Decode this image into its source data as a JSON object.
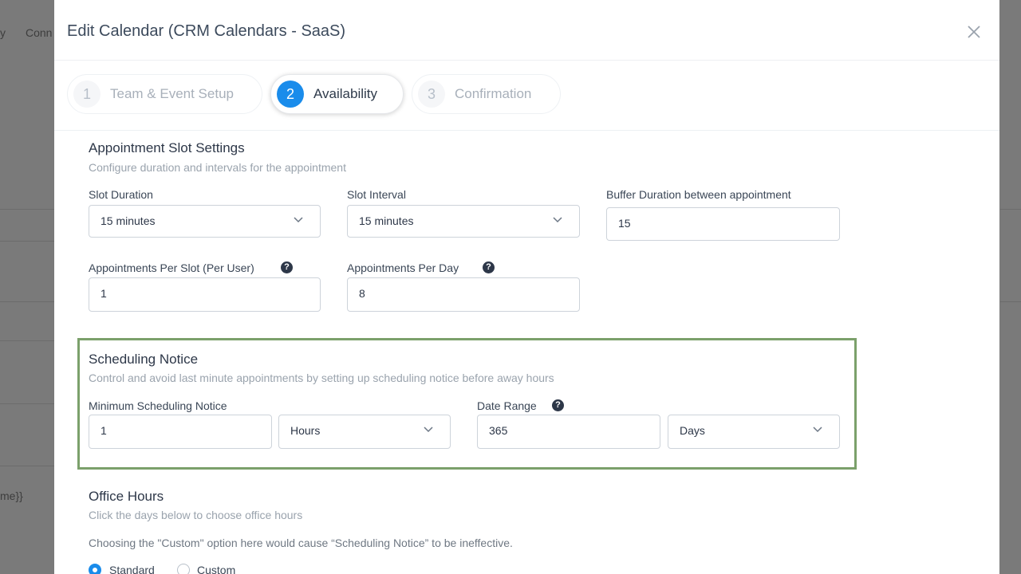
{
  "background": {
    "text_top": "y",
    "text_top2": "Conn",
    "text_left": "me}}"
  },
  "modal": {
    "title": "Edit Calendar (CRM Calendars - SaaS)"
  },
  "steps": [
    {
      "number": "1",
      "label": "Team & Event Setup",
      "active": false
    },
    {
      "number": "2",
      "label": "Availability",
      "active": true
    },
    {
      "number": "3",
      "label": "Confirmation",
      "active": false
    }
  ],
  "slot_settings": {
    "title": "Appointment Slot Settings",
    "subtitle": "Configure duration and intervals for the appointment",
    "slot_duration_label": "Slot Duration",
    "slot_duration_value": "15 minutes",
    "slot_interval_label": "Slot Interval",
    "slot_interval_value": "15 minutes",
    "buffer_label": "Buffer Duration between appointment",
    "buffer_value": "15",
    "per_slot_label": "Appointments Per Slot (Per User)",
    "per_slot_value": "1",
    "per_day_label": "Appointments Per Day",
    "per_day_value": "8"
  },
  "scheduling_notice": {
    "title": "Scheduling Notice",
    "subtitle": "Control and avoid last minute appointments by setting up scheduling notice before away hours",
    "min_notice_label": "Minimum Scheduling Notice",
    "min_notice_value": "1",
    "min_notice_unit": "Hours",
    "date_range_label": "Date Range",
    "date_range_value": "365",
    "date_range_unit": "Days"
  },
  "office_hours": {
    "title": "Office Hours",
    "subtitle": "Click the days below to choose office hours",
    "note": "Choosing the \"Custom\" option here would cause “Scheduling Notice” to be ineffective.",
    "option_standard": "Standard",
    "option_custom": "Custom",
    "selected": "Standard"
  },
  "colors": {
    "accent": "#1a8ceb",
    "highlight_border": "#7ba06b"
  }
}
